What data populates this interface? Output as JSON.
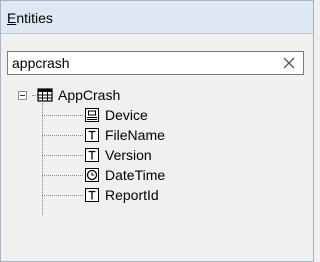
{
  "header": {
    "title_mnemonic": "E",
    "title_rest": "ntities"
  },
  "search": {
    "value": "appcrash",
    "placeholder": ""
  },
  "tree": {
    "root": {
      "label": "AppCrash",
      "icon": "table-icon"
    },
    "children": [
      {
        "label": "Device",
        "icon": "device-icon"
      },
      {
        "label": "FileName",
        "icon": "text-field-icon"
      },
      {
        "label": "Version",
        "icon": "text-field-icon"
      },
      {
        "label": "DateTime",
        "icon": "clock-icon"
      },
      {
        "label": "ReportId",
        "icon": "text-field-icon"
      }
    ]
  },
  "colors": {
    "header_bg": "#dde8f3",
    "panel_bg": "#f0f0f0",
    "border": "#a9b4c2"
  }
}
